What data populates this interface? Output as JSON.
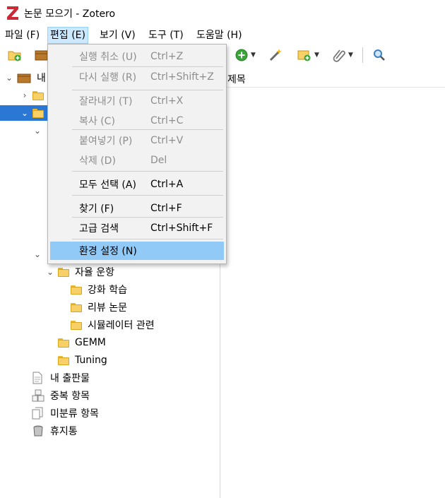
{
  "window": {
    "title": "논문 모으기 - Zotero",
    "logo_letter": "Z"
  },
  "menubar": [
    {
      "label": "파일 (F)"
    },
    {
      "label": "편집 (E)"
    },
    {
      "label": "보기 (V)"
    },
    {
      "label": "도구 (T)"
    },
    {
      "label": "도움말 (H)"
    }
  ],
  "toolbar": {
    "icons": [
      "new-collection-icon",
      "new-library-icon",
      "add-item-icon",
      "wand-icon",
      "new-note-icon",
      "attachment-icon",
      "search-icon"
    ]
  },
  "item_pane": {
    "column_title": "제목"
  },
  "tree": {
    "library_label_partial": "내",
    "items": [
      {
        "label": "자율 운항"
      },
      {
        "label": "강화 학습"
      },
      {
        "label": "리뷰 논문"
      },
      {
        "label": "시뮬레이터 관련"
      },
      {
        "label": "GEMM"
      },
      {
        "label": "Tuning"
      },
      {
        "label": "내 출판물"
      },
      {
        "label": "중복 항목"
      },
      {
        "label": "미분류 항목"
      },
      {
        "label": "휴지통"
      }
    ]
  },
  "edit_menu": {
    "items": [
      {
        "label": "실행 취소 (U)",
        "accel": "Ctrl+Z",
        "enabled": false
      },
      {
        "label": "다시 실행 (R)",
        "accel": "Ctrl+Shift+Z",
        "enabled": false
      },
      {
        "label": "잘라내기 (T)",
        "accel": "Ctrl+X",
        "enabled": false
      },
      {
        "label": "복사 (C)",
        "accel": "Ctrl+C",
        "enabled": false
      },
      {
        "label": "붙여넣기 (P)",
        "accel": "Ctrl+V",
        "enabled": false
      },
      {
        "label": "삭제 (D)",
        "accel": "Del",
        "enabled": false
      },
      {
        "label": "모두 선택 (A)",
        "accel": "Ctrl+A",
        "enabled": true
      },
      {
        "label": "찾기 (F)",
        "accel": "Ctrl+F",
        "enabled": true
      },
      {
        "label": "고급 검색",
        "accel": "Ctrl+Shift+F",
        "enabled": true
      },
      {
        "label": "환경 설정 (N)",
        "accel": "",
        "enabled": true,
        "highlighted": true
      }
    ]
  },
  "colors": {
    "selection": "#2a78d4",
    "menu_hover": "#91c9f7",
    "menu_active": "#cce8ff",
    "logo": "#cc2936"
  }
}
